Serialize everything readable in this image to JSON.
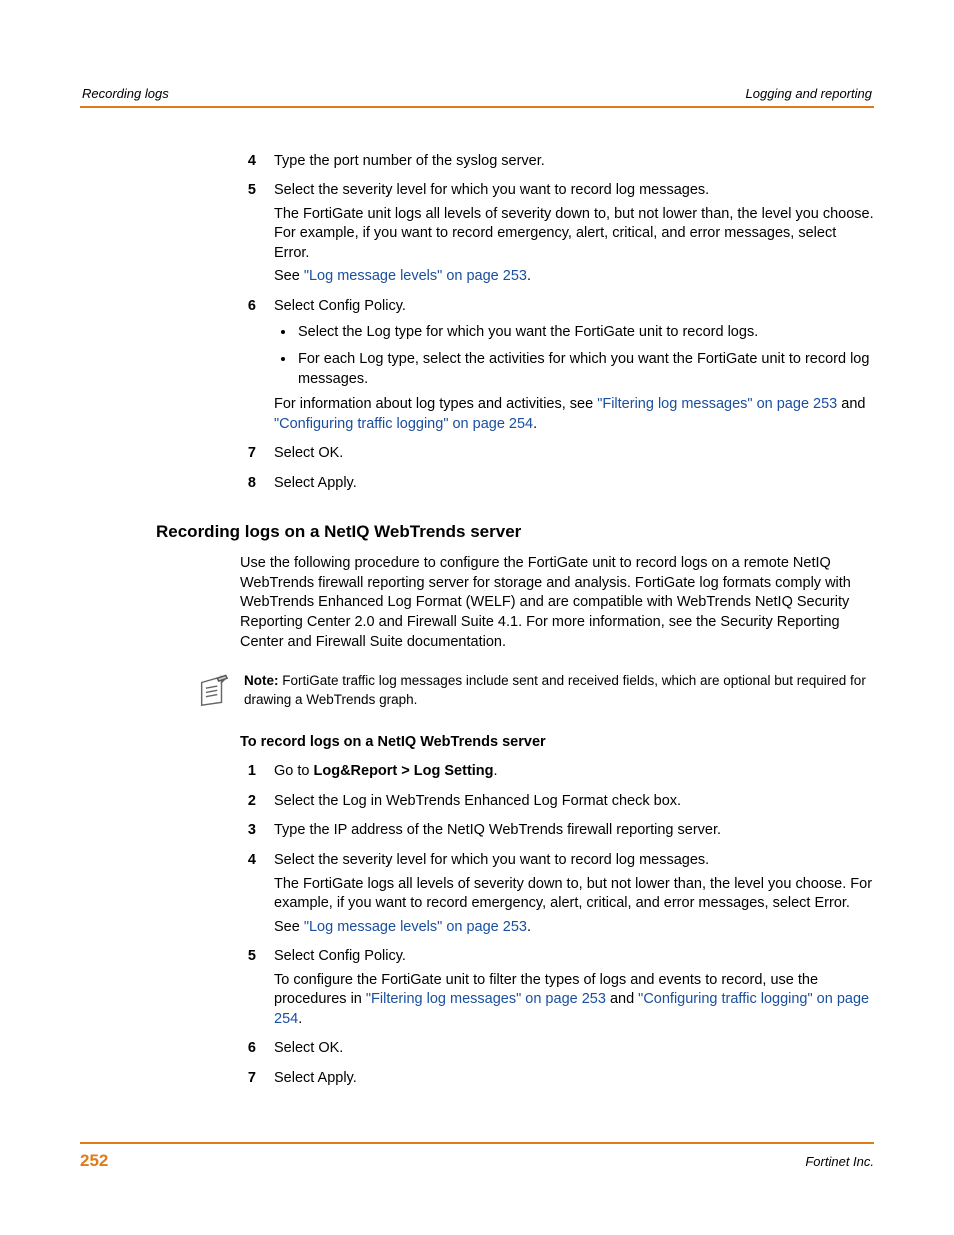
{
  "header": {
    "left": "Recording logs",
    "right": "Logging and reporting"
  },
  "list1": {
    "i4": {
      "num": "4",
      "text": "Type the port number of the syslog server."
    },
    "i5": {
      "num": "5",
      "p1": "Select the severity level for which you want to record log messages.",
      "p2": "The FortiGate unit logs all levels of severity down to, but not lower than, the level you choose. For example, if you want to record emergency, alert, critical, and error messages, select Error.",
      "p3a": "See ",
      "p3link": "\"Log message levels\" on page 253",
      "p3b": "."
    },
    "i6": {
      "num": "6",
      "p1": "Select Config Policy.",
      "b1": "Select the Log type for which you want the FortiGate unit to record logs.",
      "b2": "For each Log type, select the activities for which you want the FortiGate unit to record log messages.",
      "p2a": "For information about log types and activities, see ",
      "p2link1": "\"Filtering log messages\" on page 253",
      "p2mid": " and ",
      "p2link2": "\"Configuring traffic logging\" on page 254",
      "p2b": "."
    },
    "i7": {
      "num": "7",
      "text": "Select OK."
    },
    "i8": {
      "num": "8",
      "text": "Select Apply."
    }
  },
  "section": {
    "heading": "Recording logs on a NetIQ WebTrends server",
    "intro": "Use the following procedure to configure the FortiGate unit to record logs on a remote NetIQ WebTrends firewall reporting server for storage and analysis. FortiGate log formats comply with WebTrends Enhanced Log Format (WELF) and are compatible with WebTrends NetIQ Security Reporting Center 2.0 and Firewall Suite 4.1. For more information, see the Security Reporting Center and Firewall Suite documentation.",
    "note_label": "Note:",
    "note_text": " FortiGate traffic log messages include sent and received fields, which are optional but required for drawing a WebTrends graph.",
    "proc_title": "To record logs on a NetIQ WebTrends server"
  },
  "list2": {
    "i1": {
      "num": "1",
      "a": "Go to ",
      "bold": "Log&Report > Log Setting",
      "b": "."
    },
    "i2": {
      "num": "2",
      "text": "Select the Log in WebTrends Enhanced Log Format check box."
    },
    "i3": {
      "num": "3",
      "text": "Type the IP address of the NetIQ WebTrends firewall reporting server."
    },
    "i4": {
      "num": "4",
      "p1": "Select the severity level for which you want to record log messages.",
      "p2": "The FortiGate logs all levels of severity down to, but not lower than, the level you choose. For example, if you want to record emergency, alert, critical, and error messages, select Error.",
      "p3a": "See ",
      "p3link": "\"Log message levels\" on page 253",
      "p3b": "."
    },
    "i5": {
      "num": "5",
      "p1": "Select Config Policy.",
      "p2a": "To configure the FortiGate unit to filter the types of logs and events to record, use the procedures in ",
      "p2link1": "\"Filtering log messages\" on page 253",
      "p2mid": " and ",
      "p2link2": "\"Configuring traffic logging\" on page 254",
      "p2b": "."
    },
    "i6": {
      "num": "6",
      "text": "Select OK."
    },
    "i7": {
      "num": "7",
      "text": "Select Apply."
    }
  },
  "footer": {
    "page": "252",
    "company": "Fortinet Inc."
  }
}
